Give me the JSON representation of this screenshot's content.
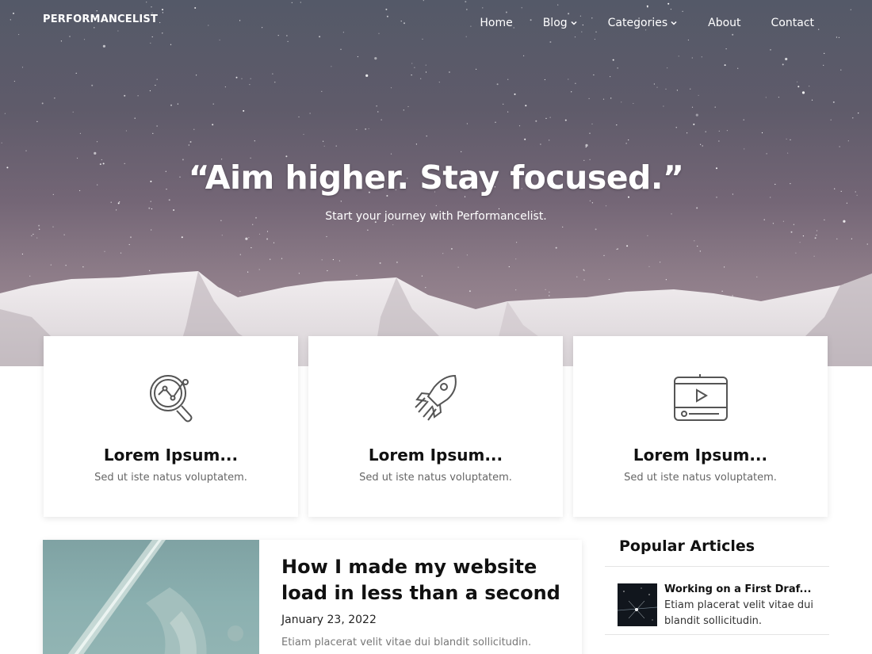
{
  "header": {
    "brand": "PERFORMANCELIST",
    "nav": [
      {
        "label": "Home",
        "has_dropdown": false
      },
      {
        "label": "Blog",
        "has_dropdown": true
      },
      {
        "label": "Categories",
        "has_dropdown": true
      },
      {
        "label": "About",
        "has_dropdown": false
      },
      {
        "label": "Contact",
        "has_dropdown": false
      }
    ]
  },
  "hero": {
    "title": "“Aim higher. Stay focused.”",
    "subtitle": "Start your journey with Performancelist."
  },
  "features": [
    {
      "icon": "analytics-search-icon",
      "title": "Lorem Ipsum...",
      "text": "Sed ut iste natus voluptatem."
    },
    {
      "icon": "rocket-icon",
      "title": "Lorem Ipsum...",
      "text": "Sed ut iste natus voluptatem."
    },
    {
      "icon": "video-player-icon",
      "title": "Lorem Ipsum...",
      "text": "Sed ut iste natus voluptatem."
    }
  ],
  "post": {
    "title": "How I made my website load in less than a second",
    "date": "January 23, 2022",
    "excerpt": "Etiam placerat velit vitae dui blandit sollicitudin."
  },
  "sidebar": {
    "title": "Popular Articles",
    "items": [
      {
        "title": "Working on a First Draf...",
        "text": "Etiam placerat velit vitae dui blandit sollicitudin."
      }
    ]
  },
  "colors": {
    "hero_sky": "#5c5b6a",
    "card_bg": "#ffffff",
    "muted_text": "#666666"
  }
}
